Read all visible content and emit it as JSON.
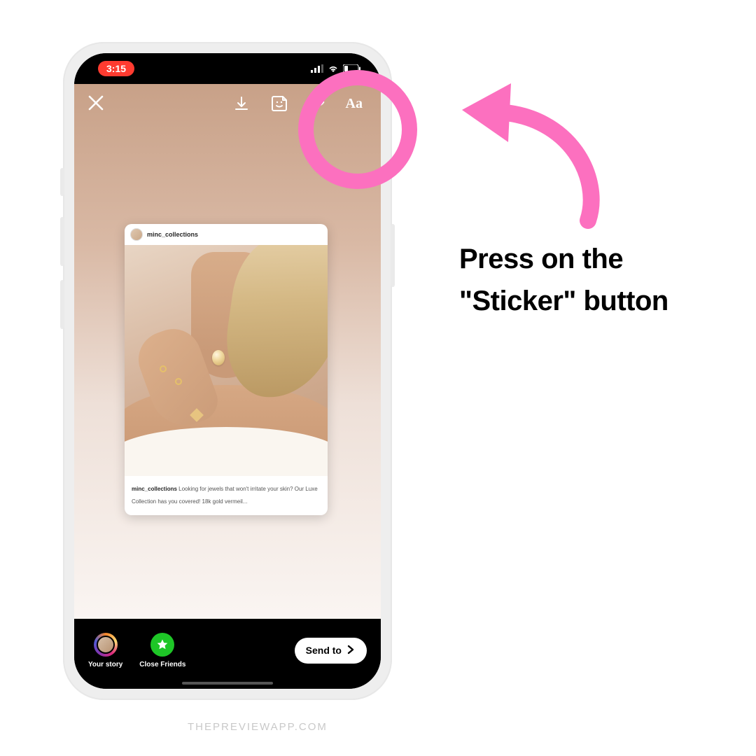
{
  "status": {
    "time": "3:15"
  },
  "editor": {
    "text_tool_label": "Aa"
  },
  "post": {
    "username": "minc_collections",
    "caption_user": "minc_collections",
    "caption_text": " Looking for jewels that won't irritate your skin? Our Luxe Collection has you covered! 18k gold vermeil..."
  },
  "bottom": {
    "your_story": "Your story",
    "close_friends": "Close Friends",
    "send_to": "Send to"
  },
  "instruction": "Press on the \"Sticker\" button",
  "watermark": "THEPREVIEWAPP.COM",
  "colors": {
    "accent_pink": "#fc70bf"
  }
}
